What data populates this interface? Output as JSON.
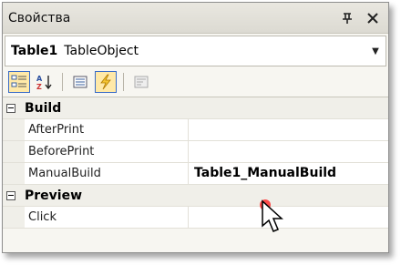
{
  "panel": {
    "title": "Свойства",
    "pin_glyph": "т",
    "close_glyph": "✕"
  },
  "object_selector": {
    "name": "Table1",
    "type": "TableObject",
    "dropdown_glyph": "▼"
  },
  "toolbar": {
    "buttons": [
      {
        "icon": "categorized-icon",
        "active": true
      },
      {
        "icon": "alphabetical-sort-icon",
        "active": false
      },
      {
        "icon": "properties-icon",
        "active": false
      },
      {
        "icon": "events-lightning-icon",
        "active": true
      },
      {
        "icon": "property-pages-icon",
        "active": false
      }
    ]
  },
  "grid": {
    "categories": [
      {
        "label": "Build",
        "rows": [
          {
            "name": "AfterPrint",
            "value": ""
          },
          {
            "name": "BeforePrint",
            "value": ""
          },
          {
            "name": "ManualBuild",
            "value": "Table1_ManualBuild"
          }
        ]
      },
      {
        "label": "Preview",
        "rows": [
          {
            "name": "Click",
            "value": ""
          }
        ]
      }
    ]
  },
  "colors": {
    "active_tool_bg": "#ffe9a8",
    "active_tool_border": "#3a6cc7",
    "lightning": "#f4c430"
  }
}
